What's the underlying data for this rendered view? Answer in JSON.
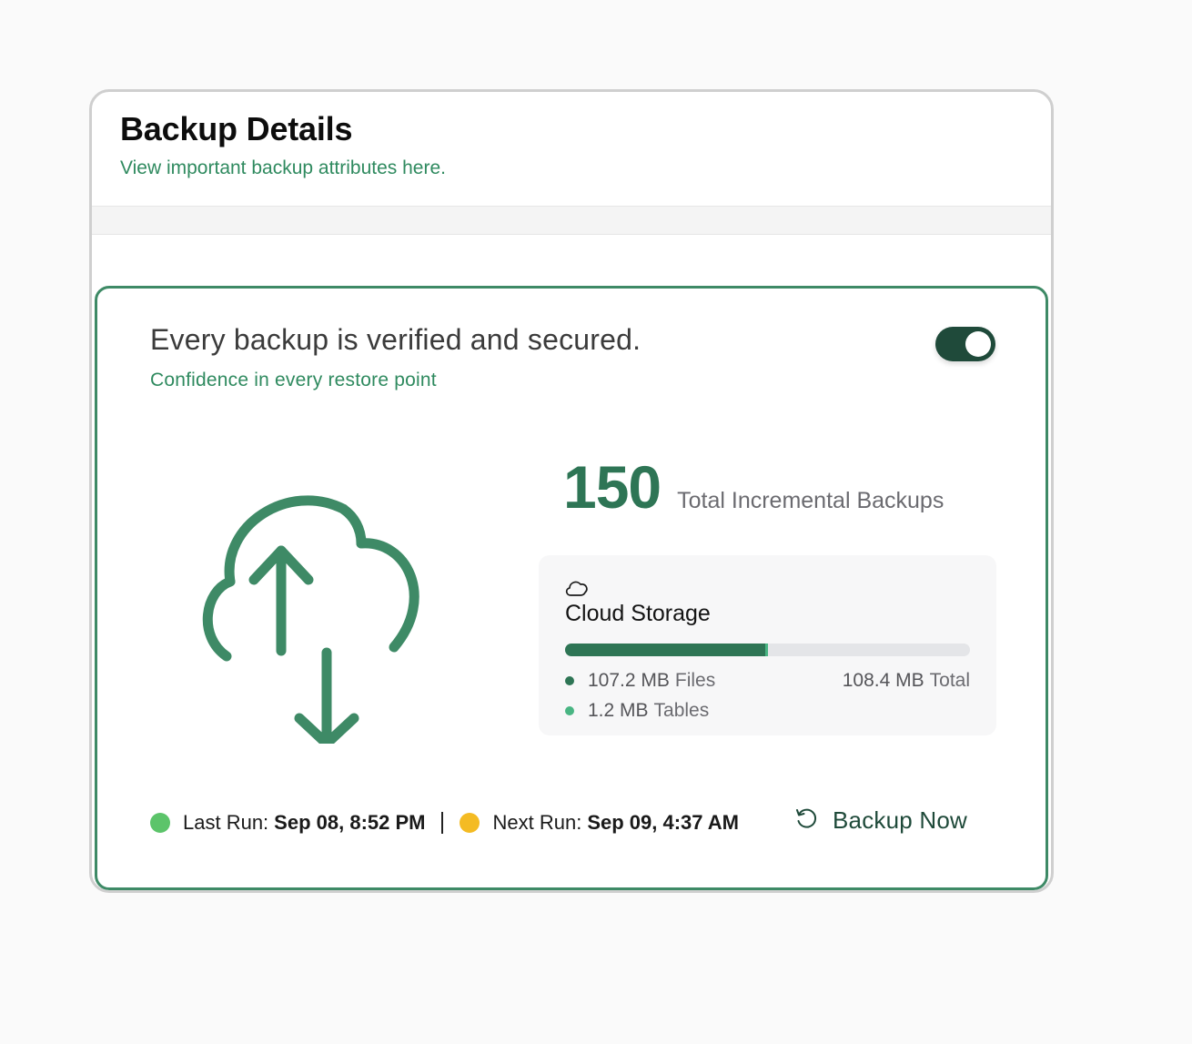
{
  "header": {
    "title": "Backup Details",
    "subtitle": "View important backup attributes here."
  },
  "card": {
    "headline": "Every backup is verified and secured.",
    "tagline": "Confidence in every restore point",
    "toggle_on": true,
    "hero_icon": "cloud-upload-download-icon"
  },
  "stats": {
    "total_incremental_backups": "150",
    "total_incremental_label": "Total Incremental Backups"
  },
  "storage": {
    "icon": "cloud-icon",
    "title": "Cloud Storage",
    "files_value": "107.2 MB",
    "files_label": "Files",
    "tables_value": "1.2 MB",
    "tables_label": "Tables",
    "total_value": "108.4 MB",
    "total_label": "Total",
    "files_fraction": 0.495,
    "tables_fraction": 0.006
  },
  "footer": {
    "last_run_label": "Last Run:",
    "last_run_value": "Sep 08, 8:52 PM",
    "next_run_label": "Next Run:",
    "next_run_value": "Sep 09, 4:37 AM",
    "backup_now_label": "Backup Now",
    "backup_now_icon": "refresh-icon"
  },
  "colors": {
    "brand_green": "#2e7555",
    "accent_green": "#49b583",
    "border_green": "#3e8a66",
    "last_run_dot": "#5cc46a",
    "next_run_dot": "#f4bb23",
    "toggle_bg": "#1f4a3a"
  }
}
